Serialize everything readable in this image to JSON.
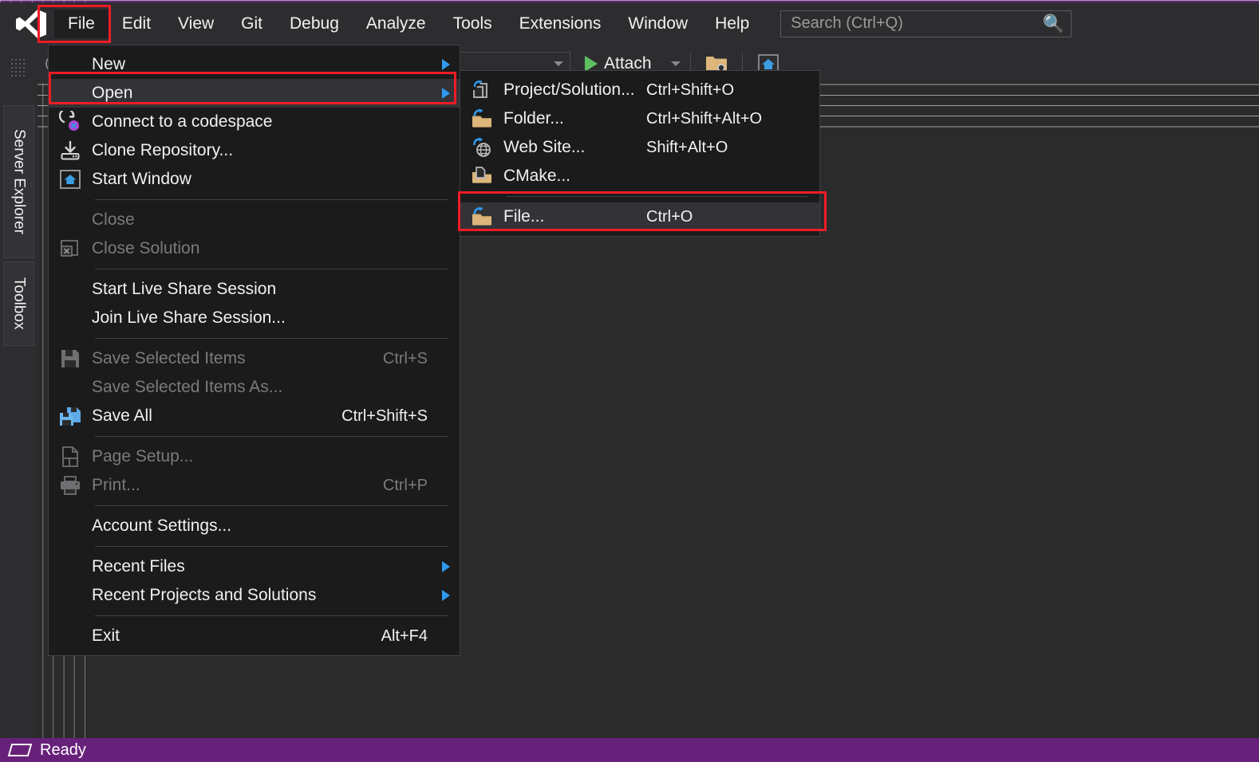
{
  "app": {
    "title": "Visual Studio",
    "logo_icon": "visual-studio-logo-icon",
    "accent_purple": "#68217a",
    "menu_bg": "#1b1b1c",
    "highlight_bg": "#333337",
    "annotation_color": "#ee1c25"
  },
  "menubar": {
    "items": [
      {
        "label": "File",
        "active": true
      },
      {
        "label": "Edit",
        "active": false
      },
      {
        "label": "View",
        "active": false
      },
      {
        "label": "Git",
        "active": false
      },
      {
        "label": "Debug",
        "active": false
      },
      {
        "label": "Analyze",
        "active": false
      },
      {
        "label": "Tools",
        "active": false
      },
      {
        "label": "Extensions",
        "active": false
      },
      {
        "label": "Window",
        "active": false
      },
      {
        "label": "Help",
        "active": false
      }
    ],
    "search": {
      "placeholder": "Search (Ctrl+Q)",
      "value": "",
      "icon": "search-icon"
    }
  },
  "left_dock": {
    "tabs": [
      {
        "label": "Server Explorer"
      },
      {
        "label": "Toolbox"
      }
    ],
    "grip_icon": "drag-grip-icon",
    "back_icon": "back-arrow-icon"
  },
  "toolbar": {
    "combo_value": "",
    "combo_caret_icon": "chevron-down-icon",
    "attach_label": "Attach",
    "attach_play_icon": "play-icon",
    "attach_caret_icon": "chevron-down-icon",
    "buttons": [
      {
        "icon": "folder-search-icon"
      },
      {
        "icon": "home-window-icon"
      }
    ]
  },
  "file_menu": {
    "rows": [
      {
        "type": "item",
        "label": "New",
        "accel": "",
        "icon": "",
        "disabled": false,
        "submenu": true,
        "highlight": false
      },
      {
        "type": "item",
        "label": "Open",
        "accel": "",
        "icon": "",
        "disabled": false,
        "submenu": true,
        "highlight": true
      },
      {
        "type": "item",
        "label": "Connect to a codespace",
        "accel": "",
        "icon": "codespace-icon",
        "disabled": false,
        "submenu": false,
        "highlight": false
      },
      {
        "type": "item",
        "label": "Clone Repository...",
        "accel": "",
        "icon": "clone-repository-icon",
        "disabled": false,
        "submenu": false,
        "highlight": false
      },
      {
        "type": "item",
        "label": "Start Window",
        "accel": "",
        "icon": "start-window-icon",
        "disabled": false,
        "submenu": false,
        "highlight": false
      },
      {
        "type": "separator"
      },
      {
        "type": "item",
        "label": "Close",
        "accel": "",
        "icon": "",
        "disabled": true,
        "submenu": false,
        "highlight": false
      },
      {
        "type": "item",
        "label": "Close Solution",
        "accel": "",
        "icon": "close-solution-icon",
        "disabled": true,
        "submenu": false,
        "highlight": false
      },
      {
        "type": "separator"
      },
      {
        "type": "item",
        "label": "Start Live Share Session",
        "accel": "",
        "icon": "",
        "disabled": false,
        "submenu": false,
        "highlight": false
      },
      {
        "type": "item",
        "label": "Join Live Share Session...",
        "accel": "",
        "icon": "",
        "disabled": false,
        "submenu": false,
        "highlight": false
      },
      {
        "type": "separator"
      },
      {
        "type": "item",
        "label": "Save Selected Items",
        "accel": "Ctrl+S",
        "icon": "save-icon",
        "disabled": true,
        "submenu": false,
        "highlight": false
      },
      {
        "type": "item",
        "label": "Save Selected Items As...",
        "accel": "",
        "icon": "",
        "disabled": true,
        "submenu": false,
        "highlight": false
      },
      {
        "type": "item",
        "label": "Save All",
        "accel": "Ctrl+Shift+S",
        "icon": "save-all-icon",
        "disabled": false,
        "submenu": false,
        "highlight": false
      },
      {
        "type": "separator"
      },
      {
        "type": "item",
        "label": "Page Setup...",
        "accel": "",
        "icon": "page-setup-icon",
        "disabled": true,
        "submenu": false,
        "highlight": false
      },
      {
        "type": "item",
        "label": "Print...",
        "accel": "Ctrl+P",
        "icon": "print-icon",
        "disabled": true,
        "submenu": false,
        "highlight": false
      },
      {
        "type": "separator"
      },
      {
        "type": "item",
        "label": "Account Settings...",
        "accel": "",
        "icon": "",
        "disabled": false,
        "submenu": false,
        "highlight": false
      },
      {
        "type": "separator"
      },
      {
        "type": "item",
        "label": "Recent Files",
        "accel": "",
        "icon": "",
        "disabled": false,
        "submenu": true,
        "highlight": false
      },
      {
        "type": "item",
        "label": "Recent Projects and Solutions",
        "accel": "",
        "icon": "",
        "disabled": false,
        "submenu": true,
        "highlight": false
      },
      {
        "type": "separator"
      },
      {
        "type": "item",
        "label": "Exit",
        "accel": "Alt+F4",
        "icon": "",
        "disabled": false,
        "submenu": false,
        "highlight": false
      }
    ]
  },
  "open_submenu": {
    "rows": [
      {
        "type": "item",
        "label": "Project/Solution...",
        "accel": "Ctrl+Shift+O",
        "icon": "open-project-icon",
        "highlight": false
      },
      {
        "type": "item",
        "label": "Folder...",
        "accel": "Ctrl+Shift+Alt+O",
        "icon": "open-folder-icon",
        "highlight": false
      },
      {
        "type": "item",
        "label": "Web Site...",
        "accel": "Shift+Alt+O",
        "icon": "open-website-icon",
        "highlight": false
      },
      {
        "type": "item",
        "label": "CMake...",
        "accel": "",
        "icon": "open-cmake-icon",
        "highlight": false
      },
      {
        "type": "separator"
      },
      {
        "type": "item",
        "label": "File...",
        "accel": "Ctrl+O",
        "icon": "open-file-icon",
        "highlight": true
      }
    ]
  },
  "annotations": [
    {
      "name": "file-menu-button-highlight"
    },
    {
      "name": "open-menu-item-highlight"
    },
    {
      "name": "open-file-menu-item-highlight"
    }
  ],
  "statusbar": {
    "glyph_icon": "ready-parallelogram-icon",
    "text": "Ready"
  }
}
